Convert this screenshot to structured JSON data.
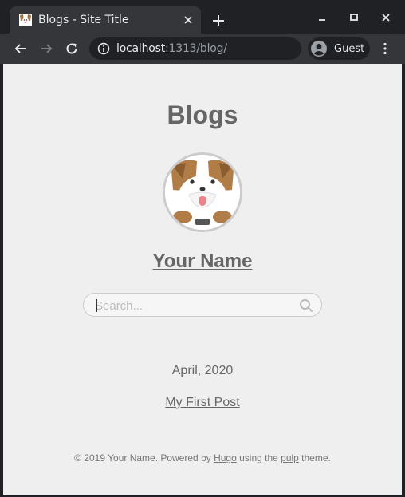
{
  "browser": {
    "tab_title": "Blogs - Site Title",
    "url_host": "localhost",
    "url_path": ":1313/blog/",
    "profile_label": "Guest"
  },
  "page": {
    "site_title": "Blogs",
    "author_name": "Your Name",
    "search_placeholder": "Search...",
    "posts": [
      {
        "month": "April, 2020",
        "title": "My First Post"
      }
    ],
    "footer": {
      "prefix": "© 2019 Your Name. Powered by ",
      "hugo_link": "Hugo",
      "middle": " using the ",
      "theme_link": "pulp",
      "suffix": " theme."
    }
  },
  "colors": {
    "browser_frame": "#202124",
    "toolbar": "#35363a",
    "page_background": "#efefef",
    "text": "#666666"
  },
  "icons": [
    "favicon-dog-icon",
    "close-icon",
    "plus-icon",
    "minimize-icon",
    "maximize-icon",
    "close-window-icon",
    "back-arrow-icon",
    "forward-arrow-icon",
    "reload-icon",
    "info-icon",
    "profile-icon",
    "kebab-menu-icon",
    "search-icon"
  ]
}
